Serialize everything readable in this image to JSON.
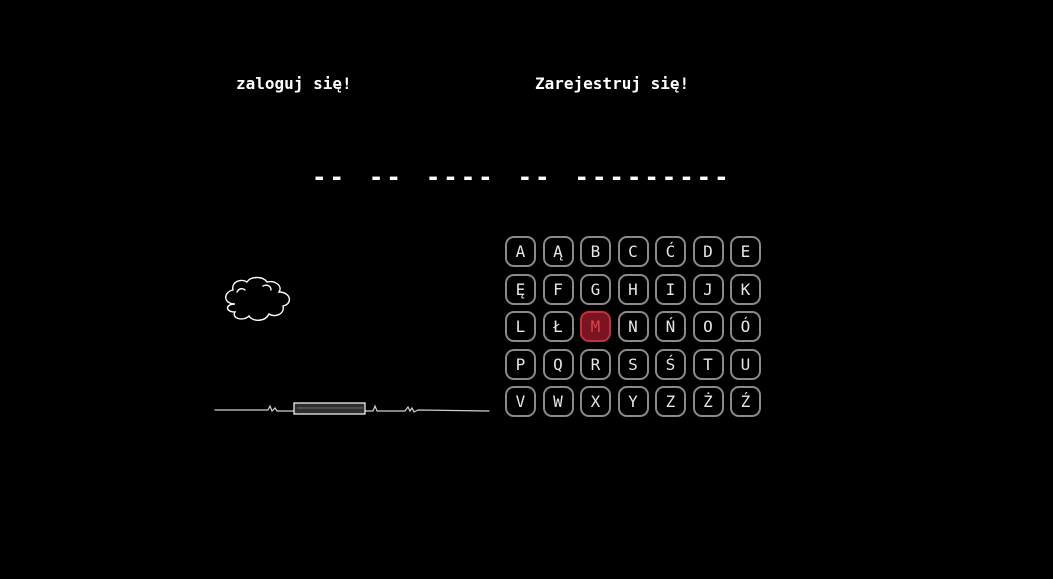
{
  "nav": {
    "login_label": "zaloguj się!",
    "register_label": "Zarejestruj się!"
  },
  "puzzle": {
    "words": [
      "--",
      "--",
      "----",
      "--",
      "---------"
    ]
  },
  "keyboard": {
    "keys": [
      {
        "letter": "A",
        "state": "unused"
      },
      {
        "letter": "Ą",
        "state": "unused"
      },
      {
        "letter": "B",
        "state": "unused"
      },
      {
        "letter": "C",
        "state": "unused"
      },
      {
        "letter": "Ć",
        "state": "unused"
      },
      {
        "letter": "D",
        "state": "unused"
      },
      {
        "letter": "E",
        "state": "unused"
      },
      {
        "letter": "Ę",
        "state": "unused"
      },
      {
        "letter": "F",
        "state": "unused"
      },
      {
        "letter": "G",
        "state": "unused"
      },
      {
        "letter": "H",
        "state": "unused"
      },
      {
        "letter": "I",
        "state": "unused"
      },
      {
        "letter": "J",
        "state": "unused"
      },
      {
        "letter": "K",
        "state": "unused"
      },
      {
        "letter": "L",
        "state": "unused"
      },
      {
        "letter": "Ł",
        "state": "unused"
      },
      {
        "letter": "M",
        "state": "wrong"
      },
      {
        "letter": "N",
        "state": "unused"
      },
      {
        "letter": "Ń",
        "state": "unused"
      },
      {
        "letter": "O",
        "state": "unused"
      },
      {
        "letter": "Ó",
        "state": "unused"
      },
      {
        "letter": "P",
        "state": "unused"
      },
      {
        "letter": "Q",
        "state": "unused"
      },
      {
        "letter": "R",
        "state": "unused"
      },
      {
        "letter": "S",
        "state": "unused"
      },
      {
        "letter": "Ś",
        "state": "unused"
      },
      {
        "letter": "T",
        "state": "unused"
      },
      {
        "letter": "U",
        "state": "unused"
      },
      {
        "letter": "V",
        "state": "unused"
      },
      {
        "letter": "W",
        "state": "unused"
      },
      {
        "letter": "X",
        "state": "unused"
      },
      {
        "letter": "Y",
        "state": "unused"
      },
      {
        "letter": "Z",
        "state": "unused"
      },
      {
        "letter": "Ż",
        "state": "unused"
      },
      {
        "letter": "Ź",
        "state": "unused"
      }
    ]
  },
  "scene": {
    "icons": [
      "cloud-icon",
      "ground-line-icon",
      "gallows-base-icon"
    ]
  },
  "colors": {
    "background": "#000000",
    "text": "#ffffff",
    "key_border": "#8a8a8a",
    "key_wrong_bg": "#7a1420",
    "key_wrong_text": "#e0424e"
  }
}
